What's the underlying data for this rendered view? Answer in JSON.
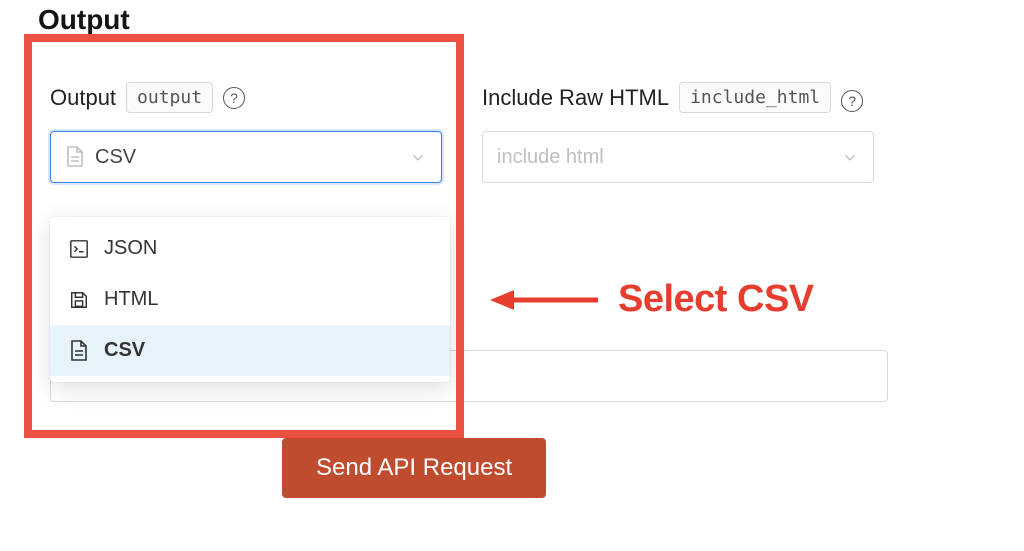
{
  "section": {
    "title": "Output"
  },
  "output_field": {
    "label": "Output",
    "code": "output",
    "selected": "CSV",
    "options": [
      {
        "label": "JSON",
        "icon": "terminal-file-icon"
      },
      {
        "label": "HTML",
        "icon": "save-file-icon"
      },
      {
        "label": "CSV",
        "icon": "document-icon"
      }
    ]
  },
  "include_html_field": {
    "label": "Include Raw HTML",
    "code": "include_html",
    "placeholder": "include html"
  },
  "annotation": {
    "text": "Select CSV"
  },
  "actions": {
    "send": "Send API Request"
  },
  "colors": {
    "accent_red": "#e63d2e",
    "button": "#c04c30",
    "highlight_border": "#ea5142"
  }
}
